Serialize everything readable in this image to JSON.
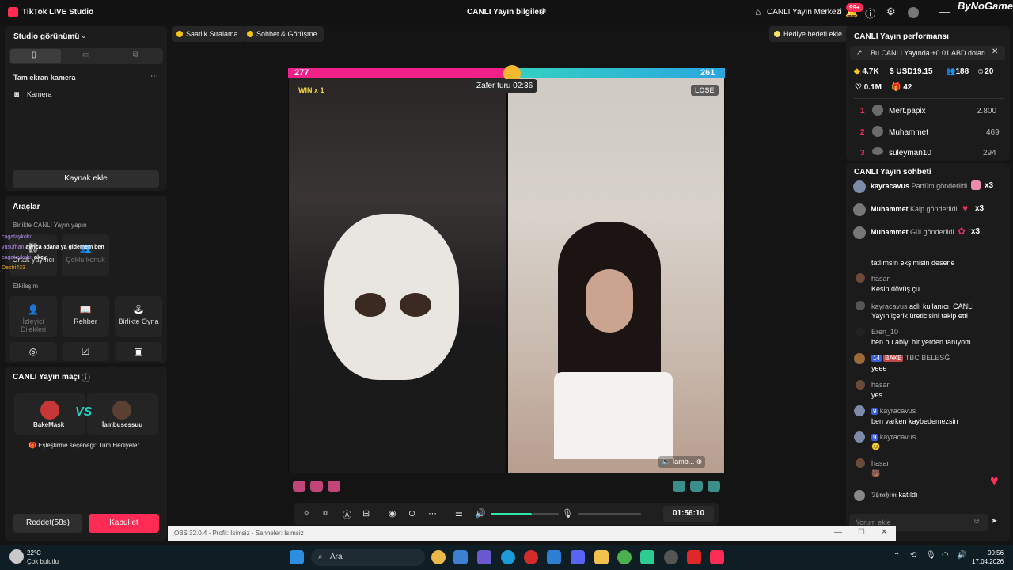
{
  "app": {
    "title": "TikTok LIVE Studio",
    "center_title": "CANLI Yayın bilgileri",
    "live_center": "CANLI Yayın Merkezi",
    "notif_badge": "99+",
    "brand": "ByNoGame"
  },
  "left": {
    "studio_view": "Studio görünümü",
    "camera_section": "Tam ekran kamera",
    "camera_item": "Kamera",
    "add_source": "Kaynak ekle",
    "tools_title": "Araçlar",
    "collab_title": "Birlikte CANLI Yayın yapın",
    "cohost": "Ortak yayıncı",
    "multi_guest": "Çoklu konuk",
    "engagement": "Etkileşim",
    "viewer_requests": "İzleyici Dilekleri",
    "guide": "Rehber",
    "play_together": "Birlikte Oyna",
    "match_title": "CANLI Yayın maçı",
    "player1": "BakeMask",
    "player2": "İambusessuu",
    "match_option": "Eşleştirme seçeneği: Tüm Hediyeler",
    "reject": "Reddet(58s)",
    "accept": "Kabul et",
    "overlay_chat": [
      {
        "name": "cagataykoki:",
        "text": ""
      },
      {
        "name": "yusufhan",
        "text": "ayrıca adana ya gidemem ben"
      },
      {
        "name": "cagataykoki:",
        "text": "okey"
      },
      {
        "name": "Destri433",
        "text": ""
      }
    ]
  },
  "top_pills": {
    "hourly": "Saatlik Sıralama",
    "chat_meet": "Sohbet & Görüşme",
    "gift_goal": "Hediye hedefi ekle"
  },
  "battle": {
    "score_left": "277",
    "score_right": "261",
    "timer": "Zafer turu 02:36",
    "win": "WIN x 1",
    "lose": "LOSE",
    "name_tag": "İamb..."
  },
  "controls": {
    "time": "01:56:10",
    "volume": 0.6
  },
  "right": {
    "perf_title": "CANLI Yayın performansı",
    "promo": "Bu CANLI Yayında +0.01 ABD doları",
    "stats": {
      "coins": "4.7K",
      "usd": "USD19.15",
      "viewers": "188",
      "followers": "20",
      "likes": "0.1M",
      "gifts": "42"
    },
    "ranking": [
      {
        "rank": "1",
        "name": "Mert.papix",
        "value": "2.800"
      },
      {
        "rank": "2",
        "name": "Muhammet",
        "value": "469"
      },
      {
        "rank": "3",
        "name": "suleyman10",
        "value": "294"
      }
    ],
    "chat_title": "CANLI Yayın sohbeti",
    "gifts": [
      {
        "name": "kayracavus",
        "text": "Parfüm gönderildi",
        "count": "x3",
        "color": "#f08bb0"
      },
      {
        "name": "Muhammet",
        "text": "Kalp gönderildi",
        "count": "x3",
        "color": "#ff2d55"
      },
      {
        "name": "Muhammet",
        "text": "Gül gönderildi",
        "count": "x3",
        "color": "#e0305a"
      }
    ],
    "messages": [
      {
        "name": "",
        "text": "tatlımsın ekşimisin desene"
      },
      {
        "name": "hasan",
        "text": "Kesin dövüş çu"
      },
      {
        "name": "kayracavus",
        "text": "adlı kullanıcı, CANLI Yayın içerik üreticisini takip etti"
      },
      {
        "name": "Eren_10",
        "text": "ben bu abiyi bir yerden tanıyom"
      },
      {
        "name": "TBC BELESĞ",
        "text": "yeee",
        "badge": "14",
        "tag": "BAKE"
      },
      {
        "name": "hasan",
        "text": "yes"
      },
      {
        "name": "kayracavus",
        "text": "ben varken kaybedemezsin",
        "badge": "9"
      },
      {
        "name": "kayracavus",
        "text": "😊",
        "badge": "9"
      },
      {
        "name": "hasan",
        "text": "🐻"
      },
      {
        "name": "𝕴𝖇𝖗𝖆𝖍𝖎𝖒",
        "text": "katıldı"
      }
    ],
    "comment_placeholder": "Yorum ekle"
  },
  "obs": {
    "text": "OBS 32.0.4 - Profil: İsimsiz - Sahneler: İsimsiz"
  },
  "taskbar": {
    "temp": "22°C",
    "weather": "Çok bulutlu",
    "search": "Ara",
    "time": "00:56",
    "date": "17.04.2026"
  }
}
